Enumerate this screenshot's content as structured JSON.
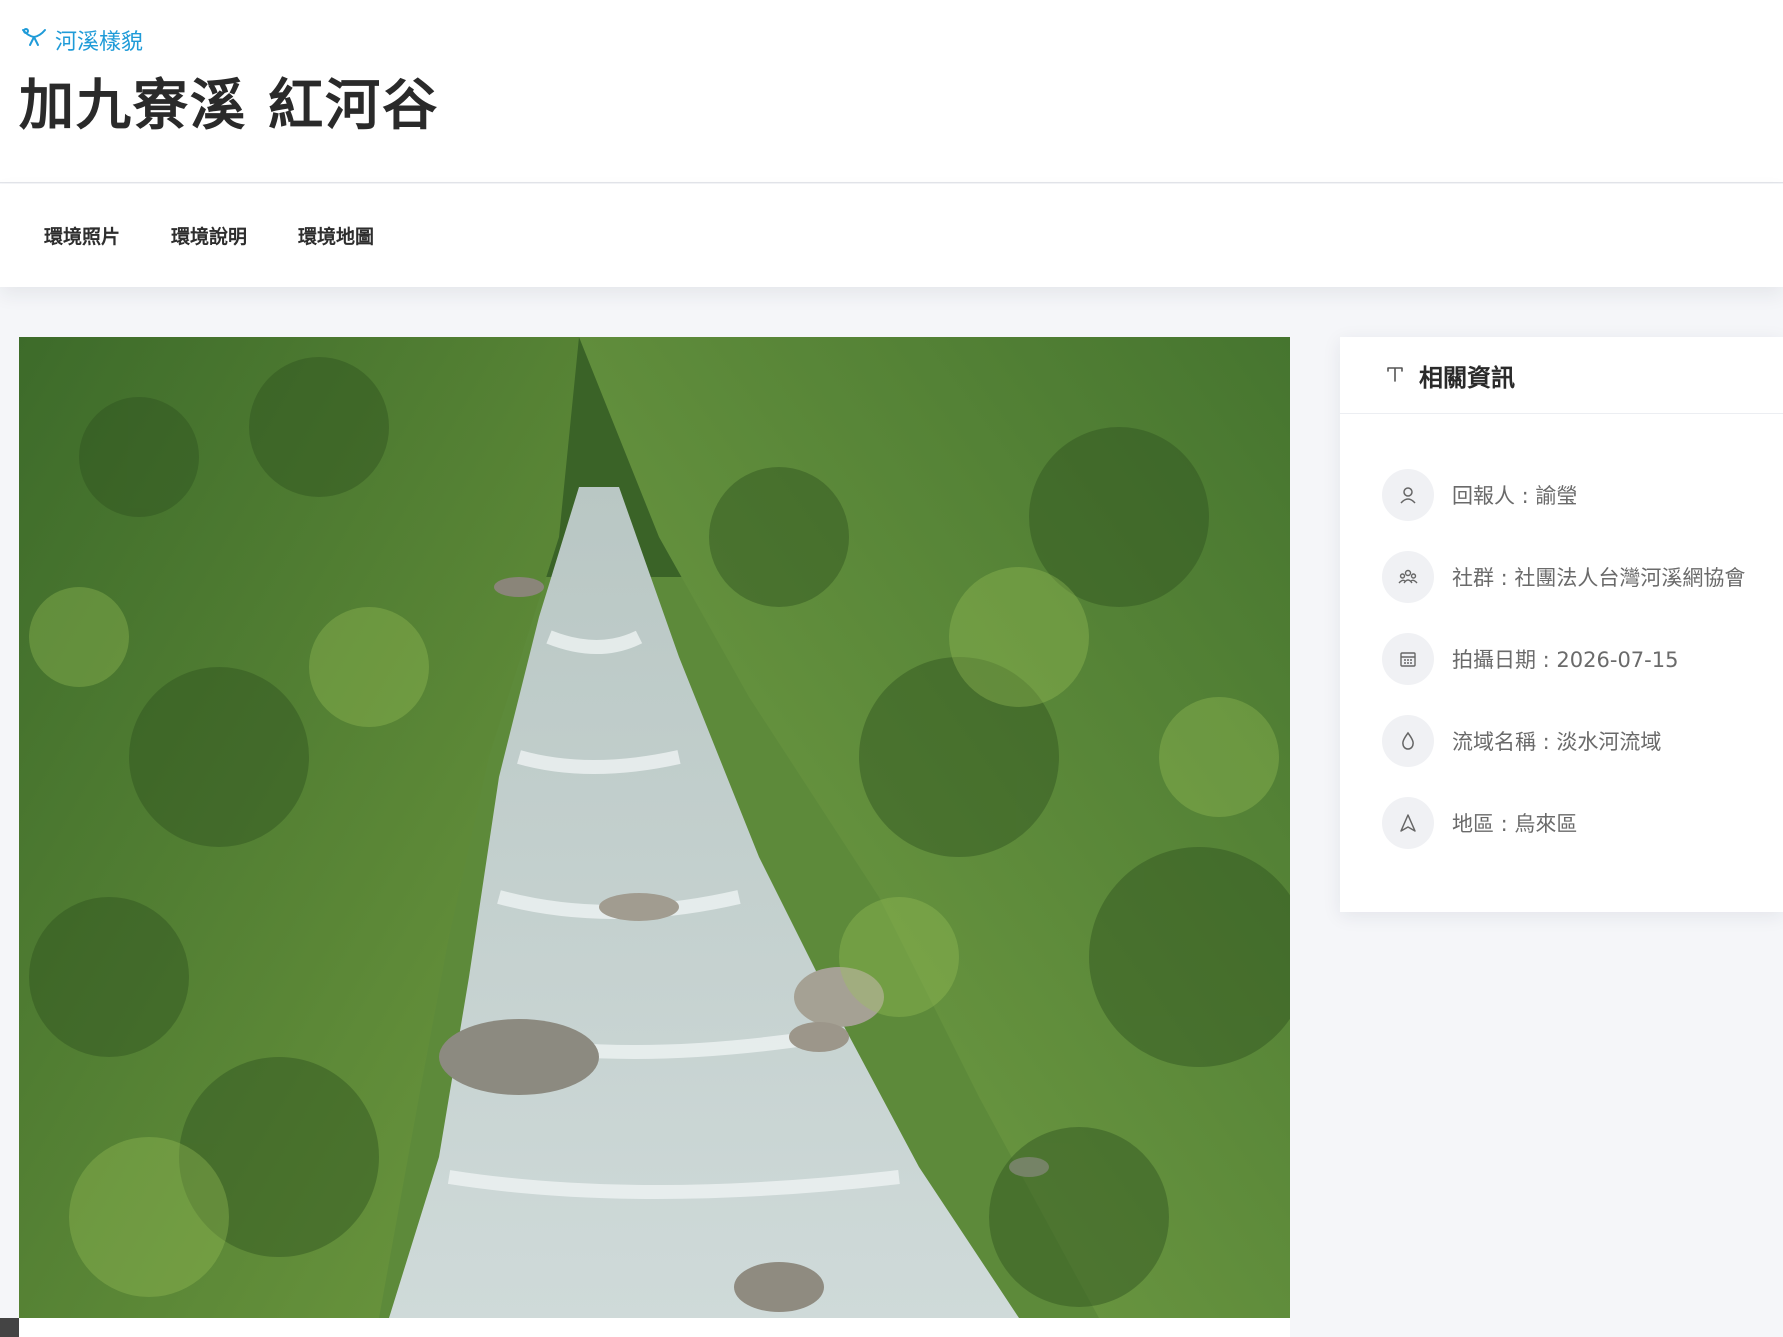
{
  "breadcrumb": {
    "label": "河溪樣貌",
    "icon": "branch-icon",
    "color": "#1f9bd8"
  },
  "page": {
    "title": "加九寮溪 紅河谷"
  },
  "tabs": [
    {
      "label": "環境照片"
    },
    {
      "label": "環境說明"
    },
    {
      "label": "環境地圖"
    }
  ],
  "photo": {
    "alt": "加九寮溪 紅河谷"
  },
  "info": {
    "title": "相關資訊",
    "title_icon": "signpost-icon",
    "items": [
      {
        "icon": "user-icon",
        "text": "回報人 : 諭瑩"
      },
      {
        "icon": "group-icon",
        "text": "社群 : 社團法人台灣河溪網協會"
      },
      {
        "icon": "calendar-icon",
        "text": "拍攝日期 : 2026-07-15"
      },
      {
        "icon": "water-drop-icon",
        "text": "流域名稱 : 淡水河流域"
      },
      {
        "icon": "region-icon",
        "text": "地區 : 烏來區"
      }
    ]
  },
  "colors": {
    "accent": "#1f9bd8",
    "background": "#f5f6f9",
    "card": "#ffffff"
  }
}
